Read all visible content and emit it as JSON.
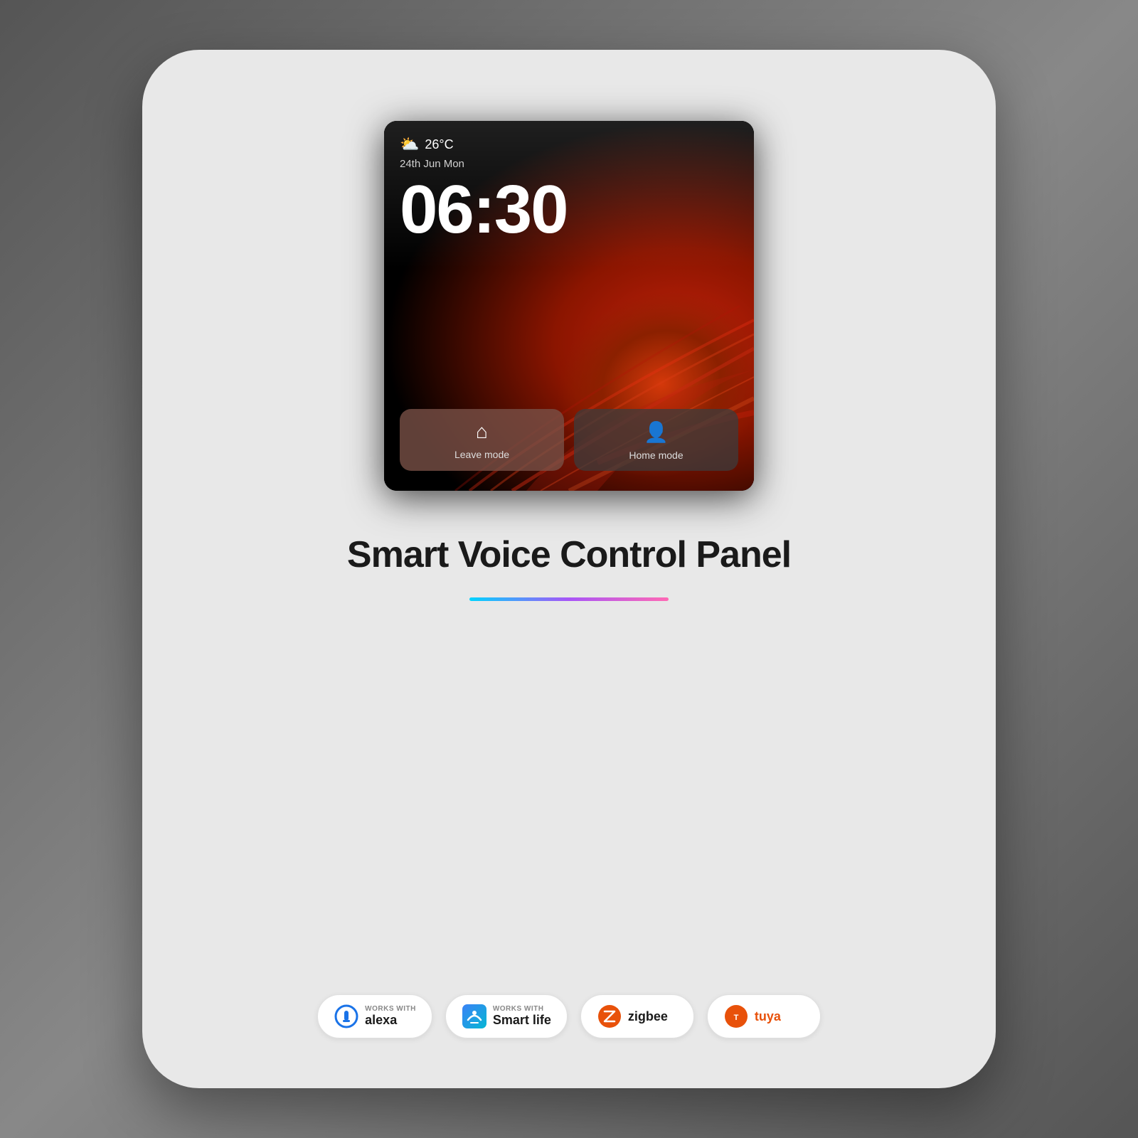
{
  "background": {
    "color": "#6b6b6b"
  },
  "card": {
    "border_radius": "80px",
    "background": "#e8e8e8"
  },
  "device_screen": {
    "temperature": "26°C",
    "date": "24th Jun Mon",
    "time": "06:30",
    "weather_icon": "⛅",
    "mode_buttons": [
      {
        "label": "Leave mode",
        "icon": "🏠",
        "active": true
      },
      {
        "label": "Home mode",
        "icon": "👤",
        "active": false
      }
    ]
  },
  "product": {
    "title": "Smart Voice Control Panel"
  },
  "badges": [
    {
      "works_with_label": "WORKS WITH",
      "name": "alexa",
      "display_name": "alexa",
      "type": "alexa"
    },
    {
      "works_with_label": "WORKS WITH",
      "name": "Smart life",
      "display_name": "Smart life",
      "type": "smartlife"
    },
    {
      "works_with_label": "",
      "name": "zigbee",
      "display_name": "zigbee",
      "type": "zigbee"
    },
    {
      "works_with_label": "",
      "name": "tuya",
      "display_name": "tuya",
      "type": "tuya"
    }
  ]
}
